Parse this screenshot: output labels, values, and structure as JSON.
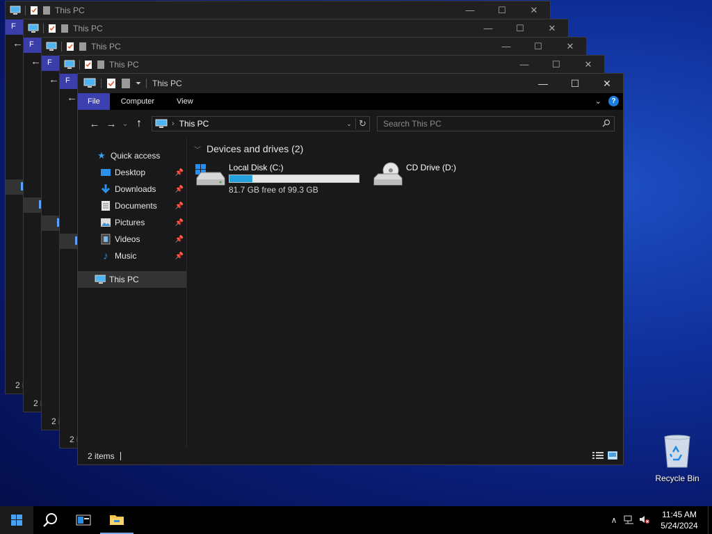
{
  "window": {
    "title": "This PC",
    "controls": {
      "minimize": "—",
      "maximize": "☐",
      "close": "✕"
    }
  },
  "ribbon": {
    "tabs": [
      "File",
      "Computer",
      "View"
    ]
  },
  "navbar": {
    "back": "←",
    "forward": "→",
    "recent": "⌄",
    "up": "↑",
    "address_path": "This PC",
    "search_placeholder": "Search This PC"
  },
  "sidebar": {
    "quick_access": "Quick access",
    "items": [
      {
        "label": "Desktop",
        "icon": "desktop-folder-icon"
      },
      {
        "label": "Downloads",
        "icon": "downloads-folder-icon"
      },
      {
        "label": "Documents",
        "icon": "documents-folder-icon"
      },
      {
        "label": "Pictures",
        "icon": "pictures-folder-icon"
      },
      {
        "label": "Videos",
        "icon": "videos-folder-icon"
      },
      {
        "label": "Music",
        "icon": "music-folder-icon"
      }
    ],
    "this_pc": "This PC"
  },
  "content": {
    "group_header": "Devices and drives (2)",
    "drives": [
      {
        "name": "Local Disk (C:)",
        "free_text": "81.7 GB free of 99.3 GB",
        "used_fraction": 0.177
      },
      {
        "name": "CD Drive (D:)"
      }
    ]
  },
  "status": {
    "items": "2 items"
  },
  "background_windows": {
    "title": "This PC",
    "ribbon_stub": "F",
    "status_stub": "2 i"
  },
  "desktop": {
    "recycle_bin": "Recycle Bin"
  },
  "taskbar": {
    "time": "11:45 AM",
    "date": "5/24/2024"
  },
  "colors": {
    "accent_file_tab": "#3c3fb0",
    "drive_bar": "#26a0da",
    "window_bg": "#191919"
  }
}
